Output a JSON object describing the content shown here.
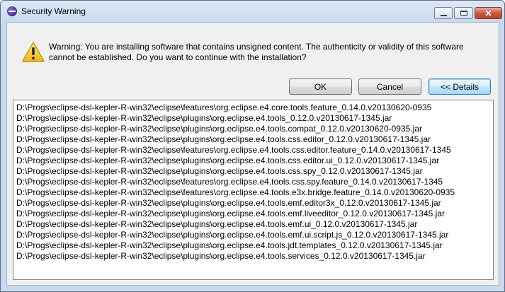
{
  "window": {
    "title": "Security Warning",
    "controls": {
      "minimize": "minimize",
      "maximize": "maximize",
      "close": "✕"
    }
  },
  "dialog": {
    "message_line1": "Warning: You are installing software that contains unsigned content. The authenticity or validity of this software",
    "message_line2": "cannot be established. Do you want to continue with the installation?",
    "buttons": {
      "ok": "OK",
      "cancel": "Cancel",
      "details": "<< Details"
    }
  },
  "details": {
    "items": [
      "D:\\Progs\\eclipse-dsl-kepler-R-win32\\eclipse\\features\\org.eclipse.e4.core.tools.feature_0.14.0.v20130620-0935",
      "D:\\Progs\\eclipse-dsl-kepler-R-win32\\eclipse\\plugins\\org.eclipse.e4.tools_0.12.0.v20130617-1345.jar",
      "D:\\Progs\\eclipse-dsl-kepler-R-win32\\eclipse\\plugins\\org.eclipse.e4.tools.compat_0.12.0.v20130620-0935.jar",
      "D:\\Progs\\eclipse-dsl-kepler-R-win32\\eclipse\\plugins\\org.eclipse.e4.tools.css.editor_0.12.0.v20130617-1345.jar",
      "D:\\Progs\\eclipse-dsl-kepler-R-win32\\eclipse\\features\\org.eclipse.e4.tools.css.editor.feature_0.14.0.v20130617-1345",
      "D:\\Progs\\eclipse-dsl-kepler-R-win32\\eclipse\\plugins\\org.eclipse.e4.tools.css.editor.ui_0.12.0.v20130617-1345.jar",
      "D:\\Progs\\eclipse-dsl-kepler-R-win32\\eclipse\\plugins\\org.eclipse.e4.tools.css.spy_0.12.0.v20130617-1345.jar",
      "D:\\Progs\\eclipse-dsl-kepler-R-win32\\eclipse\\features\\org.eclipse.e4.tools.css.spy.feature_0.14.0.v20130617-1345",
      "D:\\Progs\\eclipse-dsl-kepler-R-win32\\eclipse\\features\\org.eclipse.e4.tools.e3x.bridge.feature_0.14.0.v20130620-0935",
      "D:\\Progs\\eclipse-dsl-kepler-R-win32\\eclipse\\plugins\\org.eclipse.e4.tools.emf.editor3x_0.12.0.v20130617-1345.jar",
      "D:\\Progs\\eclipse-dsl-kepler-R-win32\\eclipse\\plugins\\org.eclipse.e4.tools.emf.liveeditor_0.12.0.v20130617-1345.jar",
      "D:\\Progs\\eclipse-dsl-kepler-R-win32\\eclipse\\plugins\\org.eclipse.e4.tools.emf.ui_0.12.0.v20130617-1345.jar",
      "D:\\Progs\\eclipse-dsl-kepler-R-win32\\eclipse\\plugins\\org.eclipse.e4.tools.emf.ui.script.js_0.12.0.v20130617-1345.jar",
      "D:\\Progs\\eclipse-dsl-kepler-R-win32\\eclipse\\plugins\\org.eclipse.e4.tools.jdt.templates_0.12.0.v20130617-1345.jar",
      "D:\\Progs\\eclipse-dsl-kepler-R-win32\\eclipse\\plugins\\org.eclipse.e4.tools.services_0.12.0.v20130617-1345.jar"
    ]
  }
}
